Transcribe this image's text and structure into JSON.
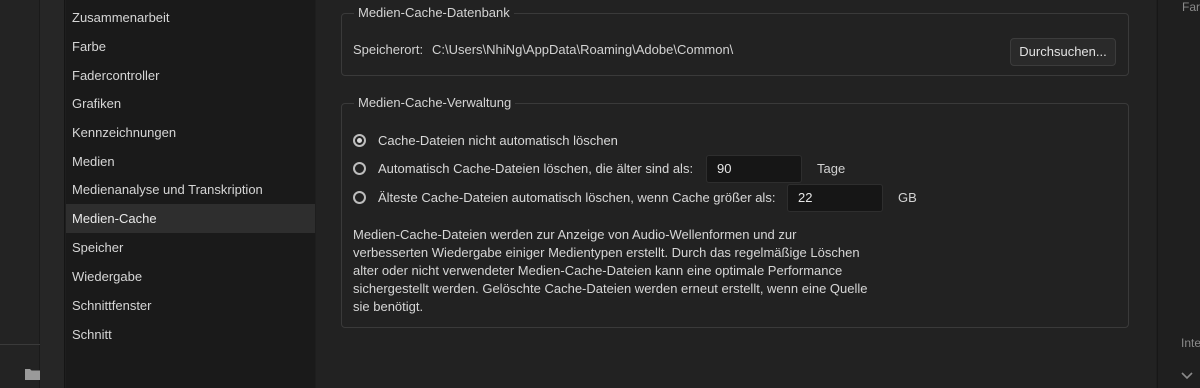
{
  "sidebar": {
    "items": [
      {
        "label": "Zusammenarbeit",
        "selected": false
      },
      {
        "label": "Farbe",
        "selected": false
      },
      {
        "label": "Fadercontroller",
        "selected": false
      },
      {
        "label": "Grafiken",
        "selected": false
      },
      {
        "label": "Kennzeichnungen",
        "selected": false
      },
      {
        "label": "Medien",
        "selected": false
      },
      {
        "label": "Medienanalyse und Transkription",
        "selected": false
      },
      {
        "label": "Medien-Cache",
        "selected": true
      },
      {
        "label": "Speicher",
        "selected": false
      },
      {
        "label": "Wiedergabe",
        "selected": false
      },
      {
        "label": "Schnittfenster",
        "selected": false
      },
      {
        "label": "Schnitt",
        "selected": false
      }
    ]
  },
  "database": {
    "title": "Medien-Cache-Datenbank",
    "location_label": "Speicherort:",
    "location_value": "C:\\Users\\NhiNg\\AppData\\Roaming\\Adobe\\Common\\",
    "browse_label": "Durchsuchen..."
  },
  "management": {
    "title": "Medien-Cache-Verwaltung",
    "options": [
      {
        "label": "Cache-Dateien nicht automatisch löschen",
        "checked": true
      },
      {
        "label": "Automatisch Cache-Dateien löschen, die älter sind als:",
        "checked": false,
        "value": "90",
        "unit": "Tage"
      },
      {
        "label": "Älteste Cache-Dateien automatisch löschen, wenn Cache größer als:",
        "checked": false,
        "value": "22",
        "unit": "GB"
      }
    ],
    "description": "Medien-Cache-Dateien werden zur Anzeige von Audio-Wellenformen und zur verbesserten Wiedergabe einiger Medientypen erstellt. Durch das regelmäßige Löschen alter oder nicht verwendeter Medien-Cache-Dateien kann eine optimale Performance sichergestellt werden. Gelöschte Cache-Dateien werden erneut erstellt, wenn eine Quelle sie benötigt."
  },
  "right_panel": {
    "top_label": "Farb",
    "bottom_label": "Inte"
  },
  "icons": {
    "folder": "folder-icon",
    "chevron": "chevron-down-icon"
  },
  "colors": {
    "background": "#222222",
    "sidebar": "#1a1a1a",
    "selected": "#2e2e2e",
    "input": "#161616"
  }
}
